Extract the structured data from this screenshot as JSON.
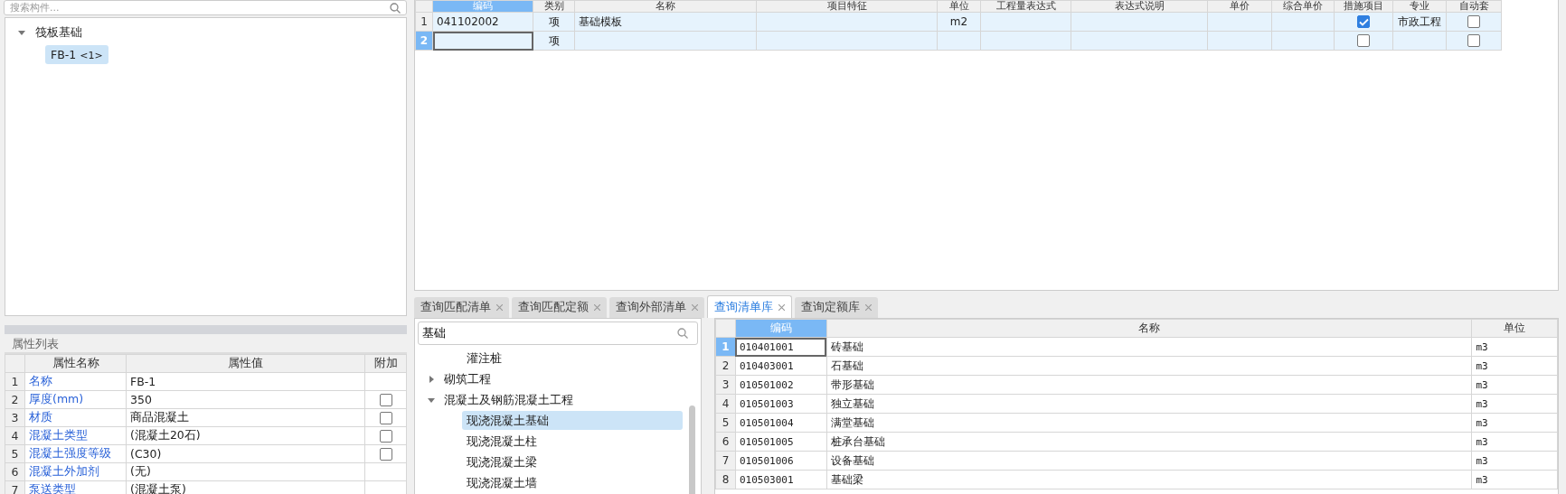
{
  "component_search": {
    "placeholder": "搜索构件..."
  },
  "component_tree": [
    {
      "label": "筏板基础",
      "expanded": true,
      "children": [
        {
          "label": "FB-1",
          "count": "<1>",
          "selected": true
        }
      ]
    }
  ],
  "bill_table": {
    "columns": [
      "编码",
      "类别",
      "名称",
      "项目特征",
      "单位",
      "工程量表达式",
      "表达式说明",
      "单价",
      "综合单价",
      "措施项目",
      "专业",
      "自动套"
    ],
    "rows": [
      {
        "number": "1",
        "selected": false,
        "code": "041102002",
        "category": "项",
        "name": "基础模板",
        "unit": "m2",
        "measure": true,
        "specialty": "市政工程",
        "auto": false
      },
      {
        "number": "2",
        "selected": true,
        "category": "项",
        "measure": false,
        "auto": false
      }
    ]
  },
  "property_list": {
    "title": "属性列表",
    "columns": [
      "属性名称",
      "属性值",
      "附加"
    ],
    "rows": [
      {
        "number": "1",
        "name": "名称",
        "value": "FB-1"
      },
      {
        "number": "2",
        "name": "厚度(mm)",
        "value": "350",
        "attached": false
      },
      {
        "number": "3",
        "name": "材质",
        "value": "商品混凝土",
        "attached": false
      },
      {
        "number": "4",
        "name": "混凝土类型",
        "value": "(混凝土20石)",
        "attached": false
      },
      {
        "number": "5",
        "name": "混凝土强度等级",
        "value": "(C30)",
        "attached": false
      },
      {
        "number": "6",
        "name": "混凝土外加剂",
        "value": "(无)"
      },
      {
        "number": "7",
        "name": "泵送类型",
        "value": "(混凝土泵)"
      }
    ]
  },
  "query_tabs": [
    {
      "label": "查询匹配清单",
      "selected": false
    },
    {
      "label": "查询匹配定额",
      "selected": false
    },
    {
      "label": "查询外部清单",
      "selected": false
    },
    {
      "label": "查询清单库",
      "selected": true
    },
    {
      "label": "查询定额库",
      "selected": false
    }
  ],
  "library_search": {
    "value": "基础"
  },
  "library_tree": [
    {
      "children": [
        {
          "label": "灌注桩",
          "selected": false
        }
      ]
    },
    {
      "label": "砌筑工程",
      "expanded": false,
      "selected": false
    },
    {
      "label": "混凝土及钢筋混凝土工程",
      "expanded": true,
      "selected": false,
      "children": [
        {
          "label": "现浇混凝土基础",
          "selected": true
        },
        {
          "label": "现浇混凝土柱",
          "selected": false
        },
        {
          "label": "现浇混凝土梁",
          "selected": false
        },
        {
          "label": "现浇混凝土墙",
          "selected": false
        }
      ]
    }
  ],
  "library_table": {
    "columns": [
      "编码",
      "名称",
      "单位"
    ],
    "rows": [
      {
        "number": "1",
        "selected": true,
        "code": "010401001",
        "name": "砖基础",
        "unit": "m3"
      },
      {
        "number": "2",
        "selected": false,
        "code": "010403001",
        "name": "石基础",
        "unit": "m3"
      },
      {
        "number": "3",
        "selected": false,
        "code": "010501002",
        "name": "带形基础",
        "unit": "m3"
      },
      {
        "number": "4",
        "selected": false,
        "code": "010501003",
        "name": "独立基础",
        "unit": "m3"
      },
      {
        "number": "5",
        "selected": false,
        "code": "010501004",
        "name": "满堂基础",
        "unit": "m3"
      },
      {
        "number": "6",
        "selected": false,
        "code": "010501005",
        "name": "桩承台基础",
        "unit": "m3"
      },
      {
        "number": "7",
        "selected": false,
        "code": "010501006",
        "name": "设备基础",
        "unit": "m3"
      },
      {
        "number": "8",
        "selected": false,
        "code": "010503001",
        "name": "基础梁",
        "unit": "m3"
      }
    ]
  }
}
